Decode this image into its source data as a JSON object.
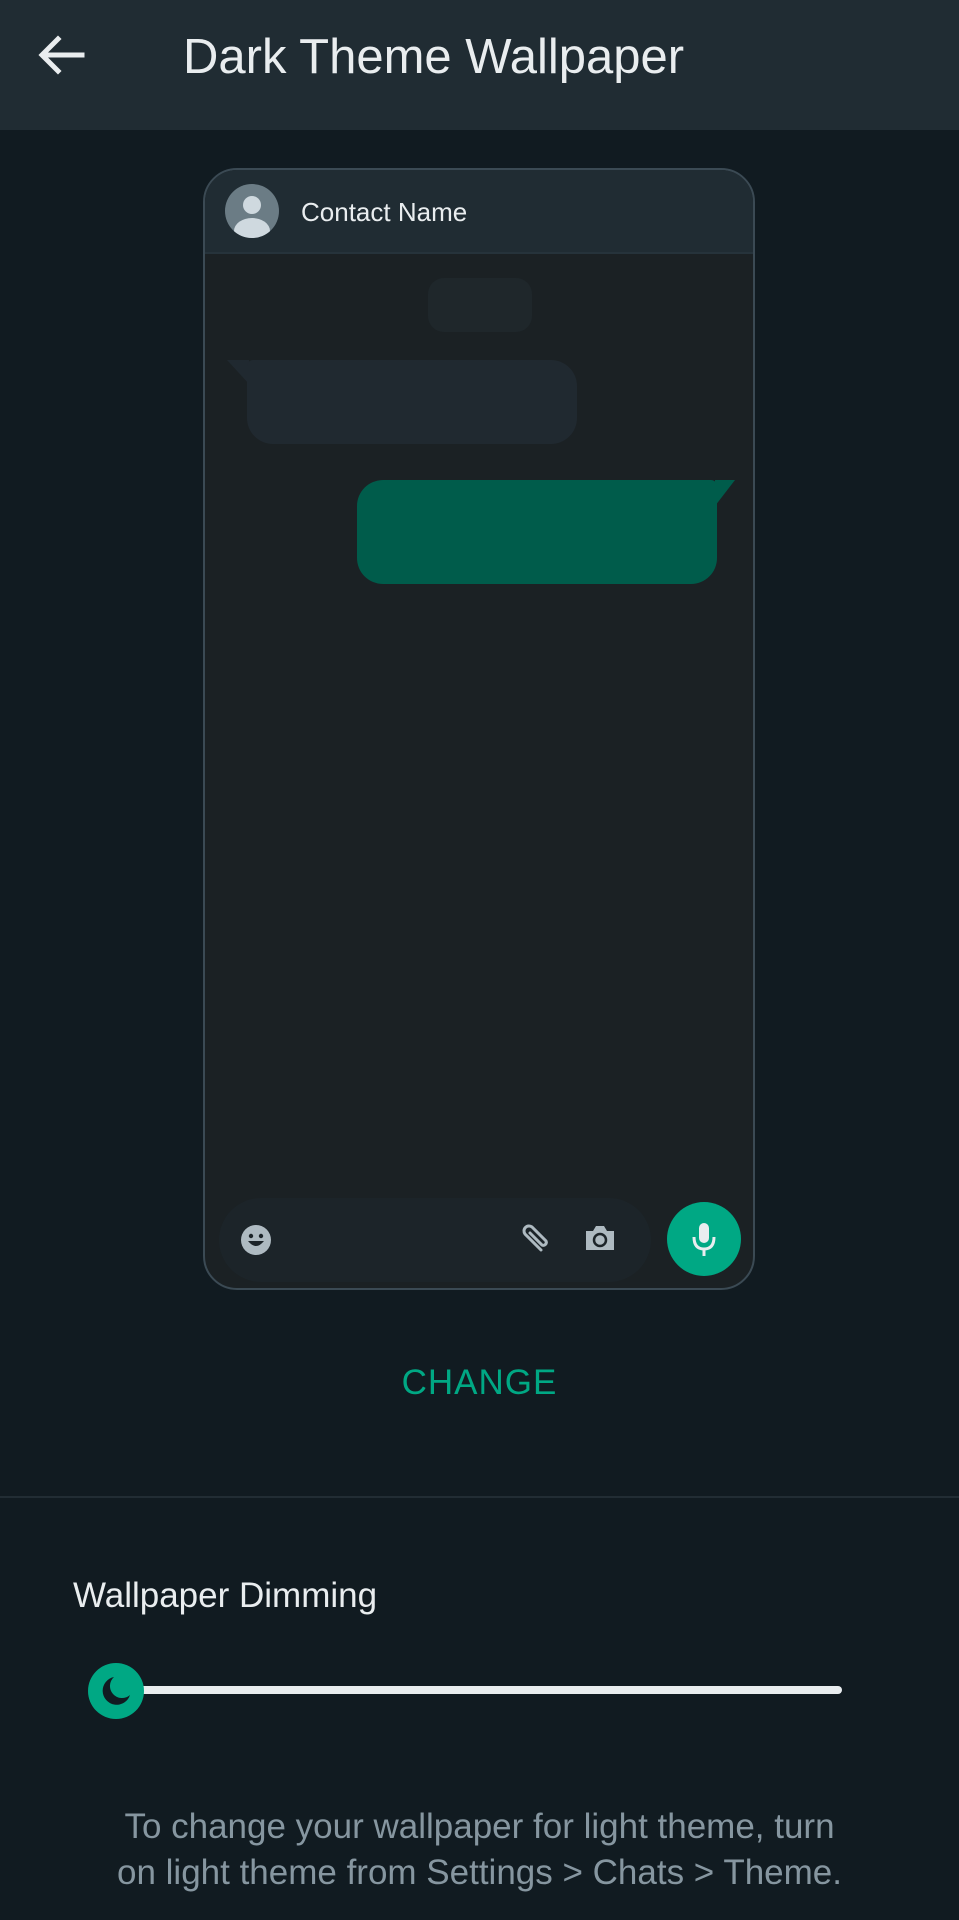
{
  "header": {
    "title": "Dark Theme Wallpaper",
    "back_icon": "arrow-left-icon"
  },
  "preview": {
    "contact_name": "Contact Name",
    "avatar_icon": "default-person-avatar-icon",
    "input_icons": [
      "emoji-icon",
      "paperclip-attach-icon",
      "camera-icon"
    ],
    "mic_icon": "microphone-icon"
  },
  "actions": {
    "change_label": "CHANGE"
  },
  "dimming": {
    "label": "Wallpaper Dimming",
    "value_percent": 0,
    "thumb_icon": "moon-icon"
  },
  "footer": {
    "line1": "To change your wallpaper for light theme, turn",
    "line2": "on light theme from Settings > Chats > Theme."
  },
  "colors": {
    "accent": "#00a884",
    "outgoing_bubble": "#005c4b",
    "incoming_bubble": "#202930",
    "background": "#111b21",
    "app_bar": "#202c33"
  }
}
